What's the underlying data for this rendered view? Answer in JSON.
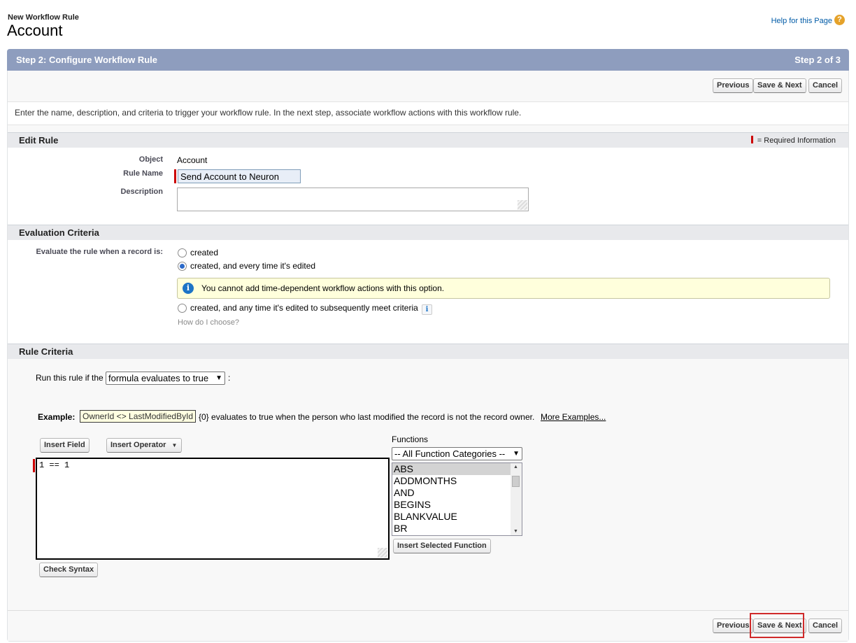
{
  "header": {
    "subtitle": "New Workflow Rule",
    "title": "Account",
    "help_link": "Help for this Page",
    "help_icon": "?"
  },
  "step_bar": {
    "title": "Step 2: Configure Workflow Rule",
    "progress": "Step 2 of 3"
  },
  "buttons": {
    "previous": "Previous",
    "save_next": "Save & Next",
    "cancel": "Cancel"
  },
  "intro": "Enter the name, description, and criteria to trigger your workflow rule. In the next step, associate workflow actions with this workflow rule.",
  "edit_rule": {
    "heading": "Edit Rule",
    "required_legend": "= Required Information",
    "object_label": "Object",
    "object_value": "Account",
    "rule_name_label": "Rule Name",
    "rule_name_value": "Send Account to Neuron",
    "description_label": "Description"
  },
  "evaluation": {
    "heading": "Evaluation Criteria",
    "label": "Evaluate the rule when a record is:",
    "options": [
      "created",
      "created, and every time it's edited",
      "created, and any time it's edited to subsequently meet criteria"
    ],
    "selected_index": 1,
    "notice": "You cannot add time-dependent workflow actions with this option.",
    "info_icon": "i",
    "help_link": "How do I choose?"
  },
  "rule_criteria": {
    "heading": "Rule Criteria",
    "run_prefix": "Run this rule if the",
    "run_select": "formula evaluates to true",
    "run_suffix": ":",
    "example_label": "Example:",
    "example_formula": "OwnerId <> LastModifiedById",
    "example_desc": "{0} evaluates to true when the person who last modified the record is not the record owner.",
    "more_examples": "More Examples...",
    "insert_field": "Insert Field",
    "insert_operator": "Insert Operator",
    "formula_value": "1 == 1",
    "functions_label": "Functions",
    "function_category": "-- All Function Categories --",
    "functions": [
      "ABS",
      "ADDMONTHS",
      "AND",
      "BEGINS",
      "BLANKVALUE",
      "BR"
    ],
    "insert_function": "Insert Selected Function",
    "check_syntax": "Check Syntax"
  }
}
